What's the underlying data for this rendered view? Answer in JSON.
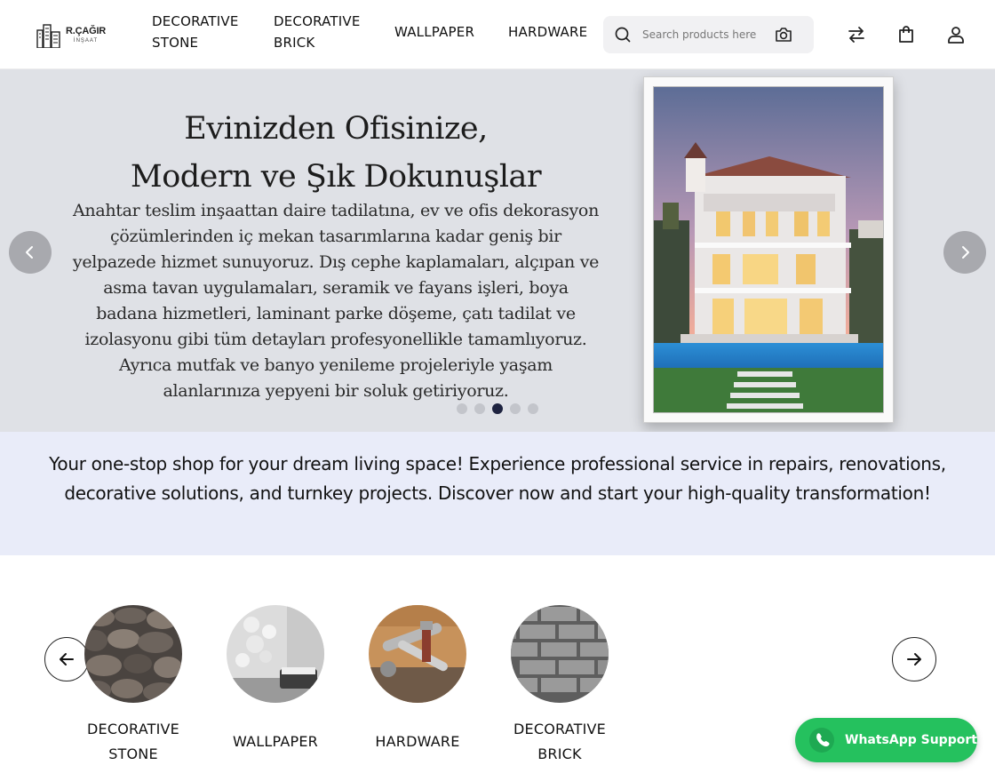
{
  "header": {
    "logo_name": "R.ÇAĞIR",
    "logo_sub": "İNŞAAT",
    "nav": [
      {
        "line1": "DECORATIVE",
        "line2": "STONE"
      },
      {
        "line1": "DECORATIVE",
        "line2": "BRICK"
      },
      {
        "line1": "WALLPAPER"
      },
      {
        "line1": "HARDWARE"
      }
    ],
    "search_placeholder": "Search products here"
  },
  "hero": {
    "title_line1": "Evinizden Ofisinize,",
    "title_line2": "Modern ve Şık Dokunuşlar",
    "text": "Anahtar teslim inşaattan daire tadilatına, ev ve ofis dekorasyon çözümlerinden iç mekan tasarımlarına kadar geniş bir yelpazede hizmet sunuyoruz. Dış cephe kaplamaları, alçıpan ve asma tavan uygulamaları, seramik ve fayans işleri, boya badana hizmetleri, laminant parke döşeme, çatı tadilat ve izolasyonu gibi tüm detayları profesyonellikle tamamlıyoruz. Ayrıca mutfak ve banyo yenileme projeleriyle yaşam alanlarınıza yepyeni bir soluk getiriyoruz.",
    "slide_count": 5,
    "active_slide": 3
  },
  "banner": {
    "text": "Your one-stop shop for your dream living space! Experience professional service in repairs, renovations, decorative solutions, and turnkey projects. Discover now and start your high-quality transformation!"
  },
  "categories": [
    {
      "line1": "DECORATIVE",
      "line2": "STONE"
    },
    {
      "line1": "WALLPAPER"
    },
    {
      "line1": "HARDWARE"
    },
    {
      "line1": "DECORATIVE",
      "line2": "BRICK"
    }
  ],
  "whatsapp": {
    "label": "WhatsApp Support"
  },
  "colors": {
    "hero_bg": "#dfe1e6",
    "banner_bg": "#e9ecf9",
    "active_dot": "#1e2340",
    "whatsapp_green": "#25c15e"
  }
}
